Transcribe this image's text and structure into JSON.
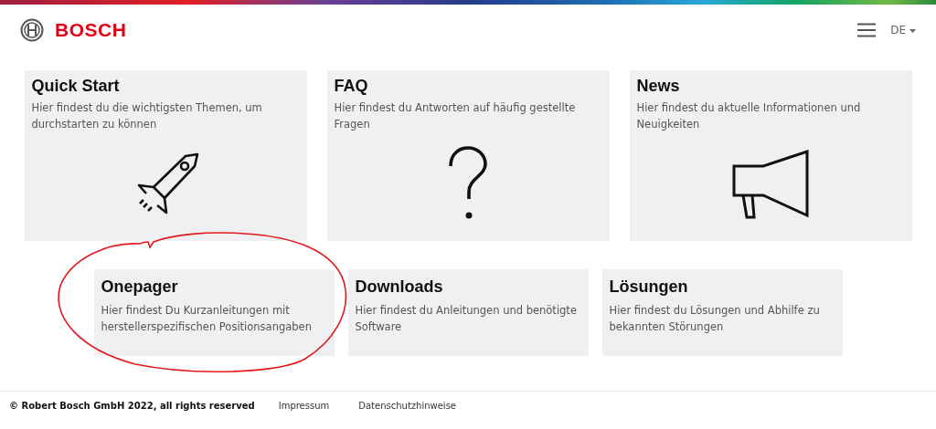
{
  "header": {
    "logo_text": "BOSCH",
    "language": "DE"
  },
  "top_cards": [
    {
      "title": "Quick Start",
      "description": "Hier findest du die wichtigsten Themen, um durchstarten zu können"
    },
    {
      "title": "FAQ",
      "description": "Hier findest du Antworten auf häufig gestellte Fragen"
    },
    {
      "title": "News",
      "description": "Hier findest du aktuelle Informationen und Neuigkeiten"
    }
  ],
  "bottom_cards": [
    {
      "title": "Onepager",
      "description": "Hier findest Du Kurzanleitungen mit herstellerspezifischen Positionsangaben",
      "highlighted": true
    },
    {
      "title": "Downloads",
      "description": "Hier findest du Anleitungen und benötigte Software",
      "highlighted": false
    },
    {
      "title": "Lösungen",
      "description": "Hier findest du Lösungen und Abhilfe zu bekannten Störungen",
      "highlighted": false
    }
  ],
  "footer": {
    "copyright": "© Robert Bosch GmbH 2022, all rights reserved",
    "links": [
      "Impressum",
      "Datenschutzhinweise"
    ]
  }
}
